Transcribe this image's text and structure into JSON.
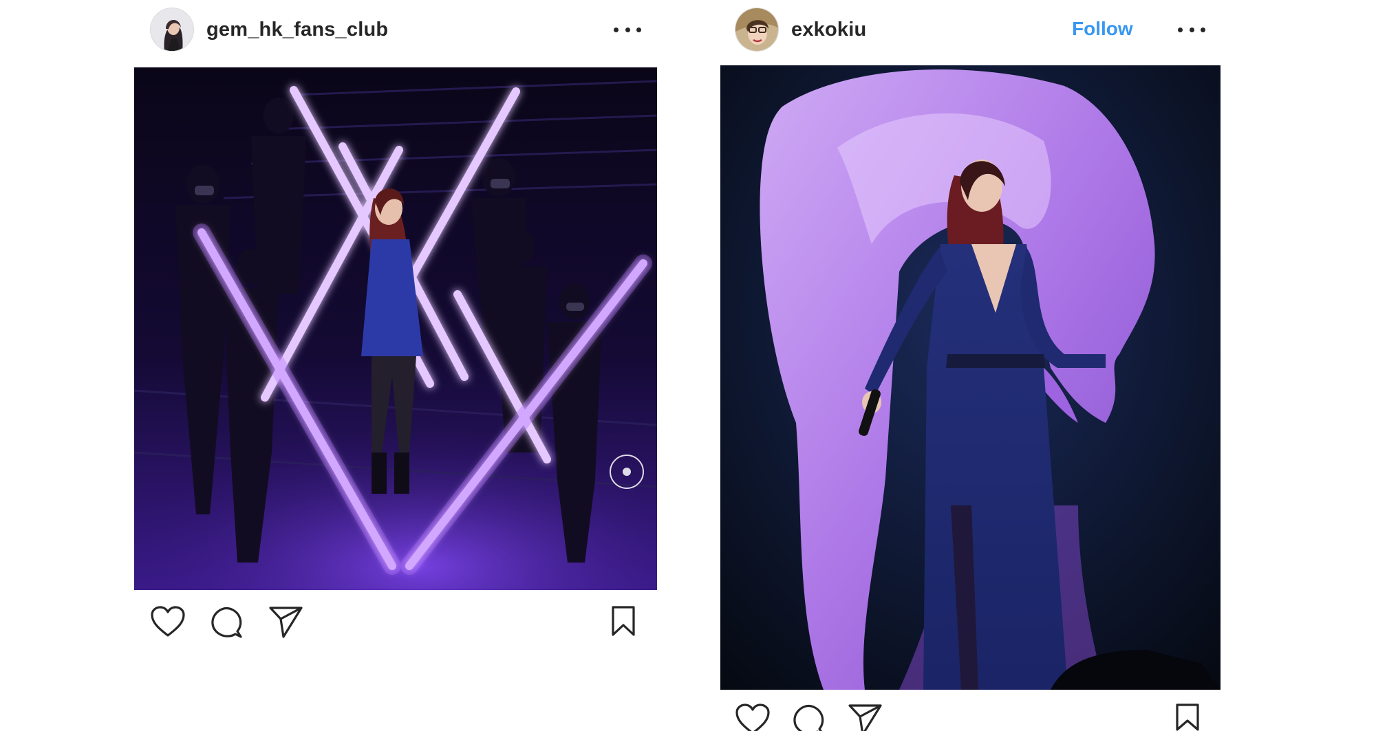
{
  "posts": [
    {
      "username": "gem_hk_fans_club",
      "show_follow": false,
      "more_icon": "more-horizontal-icon",
      "actions": [
        "heart-icon",
        "comment-icon",
        "share-icon",
        "bookmark-icon"
      ]
    },
    {
      "username": "exkokiu",
      "follow_label": "Follow",
      "show_follow": true,
      "more_icon": "more-horizontal-icon",
      "actions": [
        "heart-icon",
        "comment-icon",
        "share-icon",
        "bookmark-icon"
      ]
    }
  ],
  "colors": {
    "text": "#262626",
    "follow": "#3897f0",
    "neon": "#c77dff",
    "stage_dark": "#0b0620",
    "fabric": "#c58cf0",
    "dress": "#1d2a7a"
  }
}
